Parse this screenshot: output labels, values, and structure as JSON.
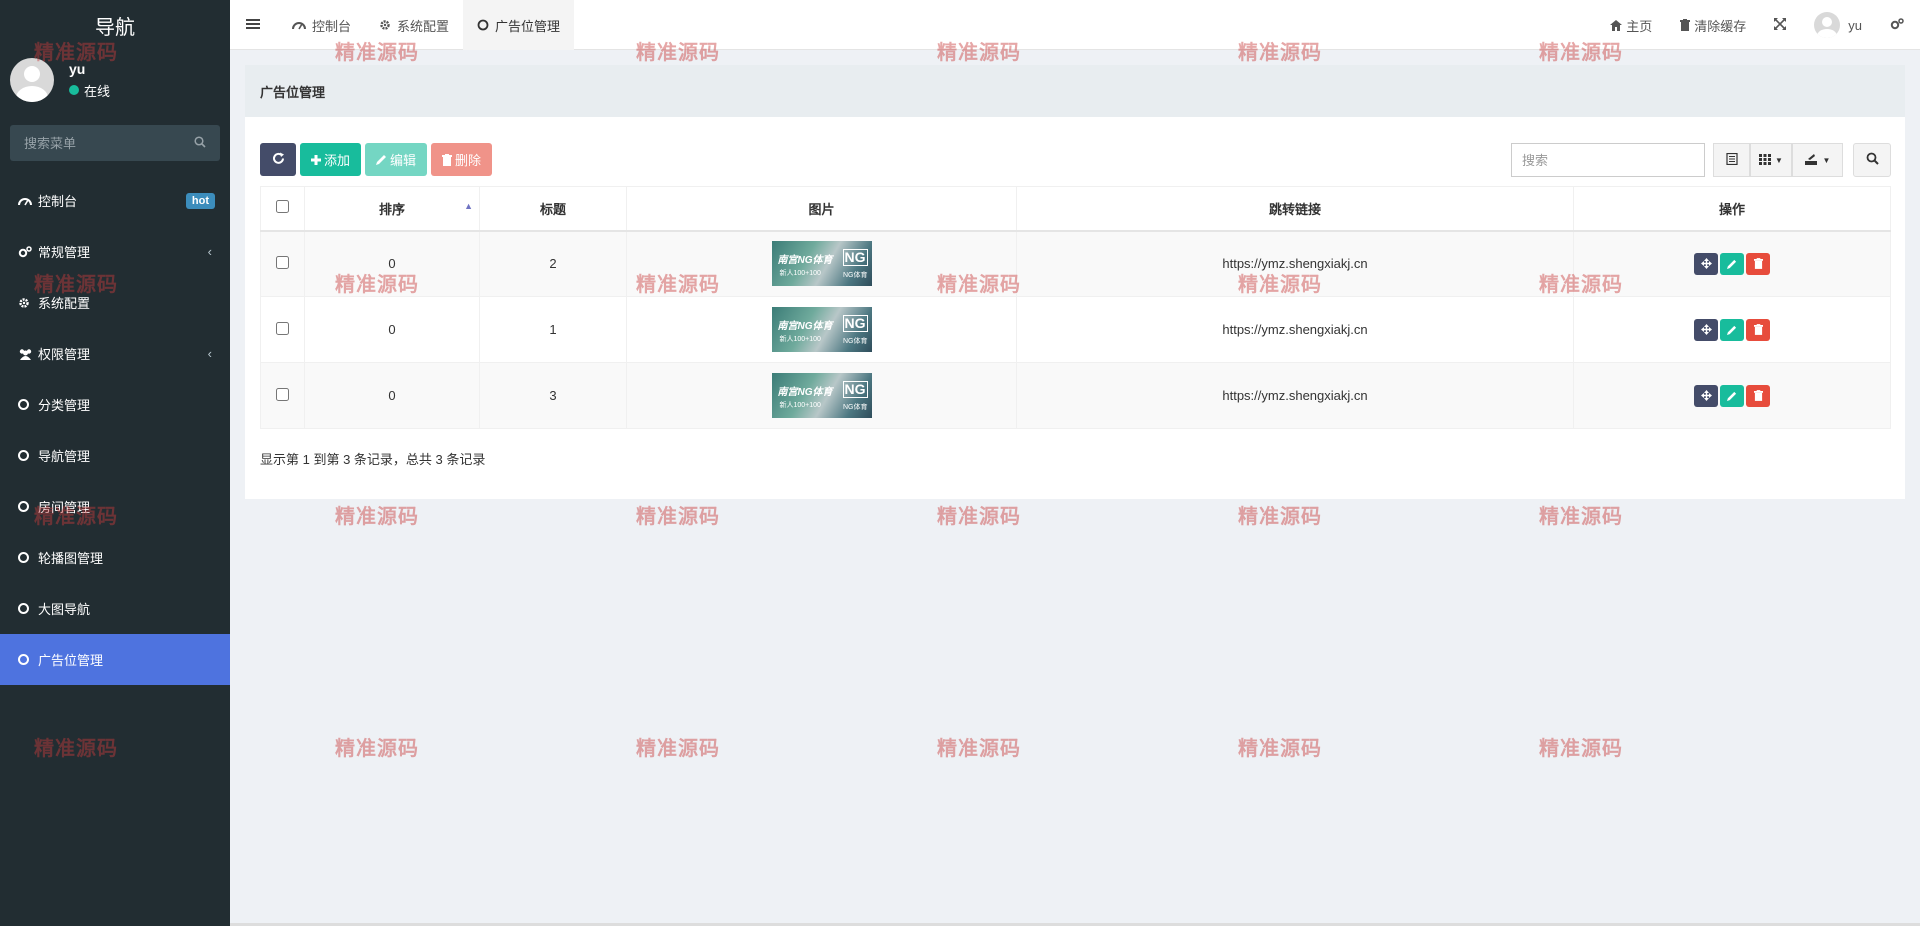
{
  "sidebar": {
    "brand": "导航",
    "user_name": "yu",
    "user_status": "在线",
    "search_placeholder": "搜索菜单",
    "items": [
      {
        "label": "控制台",
        "badge": "hot"
      },
      {
        "label": "常规管理"
      },
      {
        "label": "系统配置"
      },
      {
        "label": "权限管理"
      },
      {
        "label": "分类管理"
      },
      {
        "label": "导航管理"
      },
      {
        "label": "房间管理"
      },
      {
        "label": "轮播图管理"
      },
      {
        "label": "大图导航"
      },
      {
        "label": "广告位管理"
      }
    ]
  },
  "navbar": {
    "tabs": [
      {
        "label": "控制台"
      },
      {
        "label": "系统配置"
      },
      {
        "label": "广告位管理"
      }
    ],
    "home_label": "主页",
    "clear_cache_label": "清除缓存",
    "user_name": "yu"
  },
  "panel": {
    "heading": "广告位管理",
    "toolbar": {
      "add_label": "添加",
      "edit_label": "编辑",
      "delete_label": "删除"
    },
    "search_placeholder": "搜索",
    "table": {
      "headers": [
        "排序",
        "标题",
        "图片",
        "跳转链接",
        "操作"
      ],
      "rows": [
        {
          "sort": "0",
          "title": "2",
          "link": "https://ymz.shengxiakj.cn"
        },
        {
          "sort": "0",
          "title": "1",
          "link": "https://ymz.shengxiakj.cn"
        },
        {
          "sort": "0",
          "title": "3",
          "link": "https://ymz.shengxiakj.cn"
        }
      ]
    },
    "ad_image": {
      "text_main": "南宫NG体育",
      "text_sub": "新人100+100",
      "logo": "NG",
      "logo_sub": "NG体育"
    },
    "footer": "显示第 1 到第 3 条记录，总共 3 条记录"
  },
  "watermark": "精准源码",
  "colors": {
    "sidebar_bg": "#222d32",
    "active_menu": "#4e73df",
    "success": "#18bc9c",
    "danger": "#e74c3c",
    "dark_btn": "#444c69"
  }
}
